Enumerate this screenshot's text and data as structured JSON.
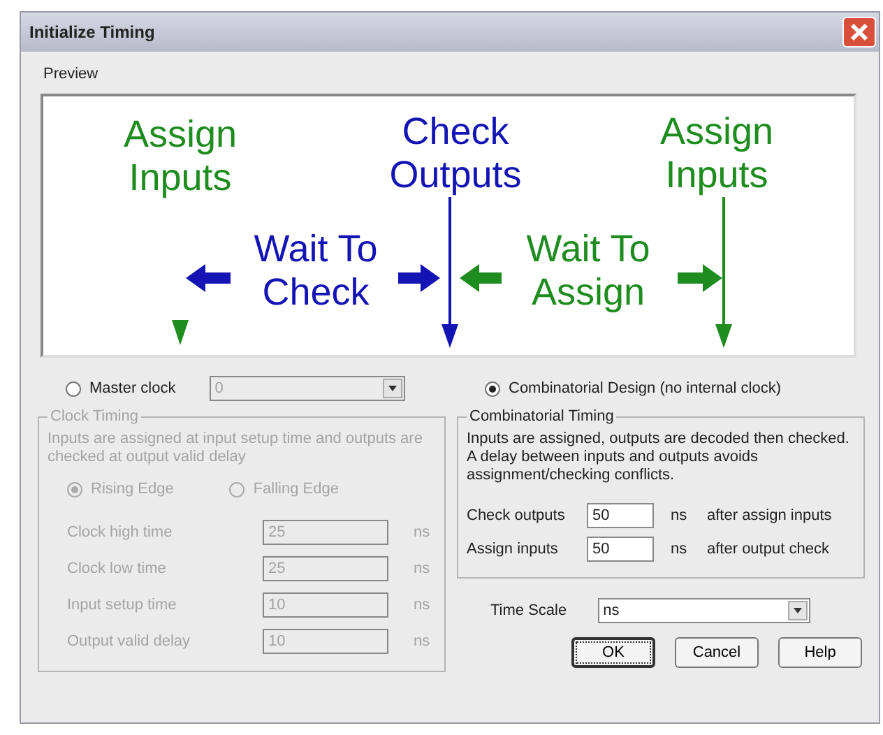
{
  "window": {
    "title": "Initialize Timing"
  },
  "preview": {
    "label": "Preview",
    "labels": [
      {
        "lines": [
          "Assign",
          "Inputs"
        ],
        "color": "#1e8c1e"
      },
      {
        "lines": [
          "Check",
          "Outputs"
        ],
        "color": "#1414b4"
      },
      {
        "lines": [
          "Assign",
          "Inputs"
        ],
        "color": "#1e8c1e"
      },
      {
        "lines": [
          "Wait To",
          "Check"
        ],
        "color": "#1414b4"
      },
      {
        "lines": [
          "Wait To",
          "Assign"
        ],
        "color": "#1e8c1e"
      }
    ]
  },
  "master_clock": {
    "label": "Master clock",
    "selected": false,
    "value": "0"
  },
  "clock_timing": {
    "title": "Clock Timing",
    "disabled": true,
    "description": "Inputs are assigned at input setup time and outputs are checked at output valid delay",
    "edges": [
      {
        "label": "Rising Edge",
        "selected": true
      },
      {
        "label": "Falling Edge",
        "selected": false
      }
    ],
    "fields": [
      {
        "label": "Clock high time",
        "value": "25",
        "unit": "ns"
      },
      {
        "label": "Clock low time",
        "value": "25",
        "unit": "ns"
      },
      {
        "label": "Input setup time",
        "value": "10",
        "unit": "ns"
      },
      {
        "label": "Output valid delay",
        "value": "10",
        "unit": "ns"
      }
    ]
  },
  "combinatorial": {
    "label": "Combinatorial Design (no internal clock)",
    "selected": true
  },
  "combinatorial_timing": {
    "title": "Combinatorial Timing",
    "disabled": false,
    "description": "Inputs are assigned, outputs are decoded then checked. A delay between inputs and outputs avoids assignment/checking conflicts.",
    "fields": [
      {
        "label": "Check outputs",
        "value": "50",
        "unit": "ns",
        "note": "after assign inputs"
      },
      {
        "label": "Assign inputs",
        "value": "50",
        "unit": "ns",
        "note": "after output check"
      }
    ]
  },
  "time_scale": {
    "label": "Time Scale",
    "value": "ns"
  },
  "buttons": [
    {
      "label": "OK",
      "default": true
    },
    {
      "label": "Cancel",
      "default": false
    },
    {
      "label": "Help",
      "default": false
    }
  ]
}
